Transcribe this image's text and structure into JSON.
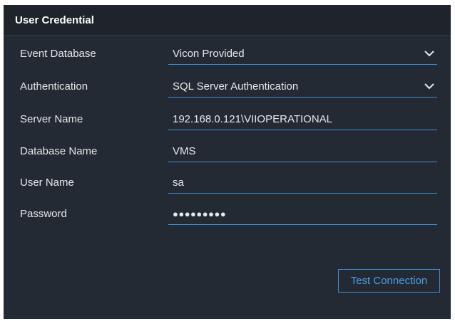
{
  "panel": {
    "title": "User Credential"
  },
  "fields": [
    {
      "label": "Event Database",
      "value": "Vicon Provided",
      "type": "dropdown"
    },
    {
      "label": "Authentication",
      "value": "SQL Server Authentication",
      "type": "dropdown"
    },
    {
      "label": "Server Name",
      "value": "192.168.0.121\\VIIOPERATIONAL",
      "type": "text"
    },
    {
      "label": "Database Name",
      "value": "VMS",
      "type": "text"
    },
    {
      "label": "User Name",
      "value": "sa",
      "type": "text"
    },
    {
      "label": "Password",
      "value": "●●●●●●●●●",
      "type": "password"
    }
  ],
  "actions": {
    "test_connection_label": "Test Connection"
  },
  "colors": {
    "panel_bg": "#242a33",
    "header_bg": "#1f242c",
    "accent": "#3d8fd6",
    "text": "#e6e8eb"
  },
  "icons": {
    "dropdown": "chevron-down-icon"
  }
}
